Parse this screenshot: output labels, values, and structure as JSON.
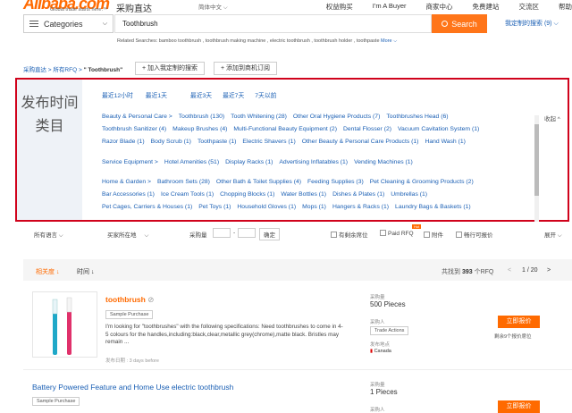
{
  "header": {
    "logo": "Alibaba.com",
    "tagline": "Global trade starts here.™",
    "site": "采购直达",
    "lang": "简体中文",
    "nav": [
      "权益购买",
      "I'm A Buyer",
      "商家中心",
      "免费建站",
      "交流区",
      "帮助"
    ]
  },
  "search": {
    "category": "Categories",
    "query": "Toothbrush",
    "button": "Search",
    "my_subs": "我定制的搜索 (9)",
    "related_label": "Related Searches:",
    "related": "bamboo toothbrush , toothbrush making machine , electric toothbrush , toothbrush holder , toothpaste",
    "more": "More"
  },
  "breadcrumb": {
    "a": "采购直达",
    "b": "所有RFQ",
    "current": "\" Toothbrush\"",
    "btn1": "+ 加入我定制的搜索",
    "btn2": "+ 添加到商机订阅"
  },
  "filters": {
    "time_label": "发布时间",
    "time": [
      "最近12小时",
      "最近1天",
      "最近3天",
      "最近7天",
      "7天以前"
    ],
    "cat_label": "类目",
    "fold": "收起",
    "row1": [
      "Beauty & Personal Care  >",
      "Toothbrush (130)",
      "Tooth Whitening (28)",
      "Other Oral Hygiene Products (7)",
      "Toothbrushes Head (6)"
    ],
    "row2": [
      "Toothbrush Sanitizer (4)",
      "Makeup Brushes (4)",
      "Multi-Functional Beauty Equipment (2)",
      "Dental Flosser (2)",
      "Vacuum Cavitation System (1)"
    ],
    "row3": [
      "Razor Blade (1)",
      "Body Scrub (1)",
      "Toothpaste (1)",
      "Electric Shavers (1)",
      "Other Beauty & Personal Care Products (1)",
      "Hand Wash (1)"
    ],
    "row4": [
      "Service Equipment  >",
      "Hotel Amenities (51)",
      "Display Racks (1)",
      "Advertising Inflatables (1)",
      "Vending Machines (1)"
    ],
    "row5": [
      "Home & Garden  >",
      "Bathroom Sets (28)",
      "Other Bath & Toilet Supplies (4)",
      "Feeding Supplies (3)",
      "Pet Cleaning & Grooming Products (2)"
    ],
    "row6": [
      "Bar Accessories (1)",
      "Ice Cream Tools (1)",
      "Chopping Blocks (1)",
      "Water Bottles (1)",
      "Dishes & Plates (1)",
      "Umbrellas (1)"
    ],
    "row7": [
      "Pet Cages, Carriers & Houses (1)",
      "Pet Toys (1)",
      "Household Gloves (1)",
      "Mops (1)",
      "Hangers & Racks (1)",
      "Laundry Bags & Baskets (1)"
    ]
  },
  "bar2": {
    "lang": "所有语言",
    "region": "买家所在地",
    "qty": "采购量",
    "dash": "-",
    "ok": "确定",
    "c1": "有剩余席位",
    "c2": "Paid RFQ",
    "c3": "附件",
    "c4": "畅行可报价",
    "hot": "Hot",
    "expand": "展开"
  },
  "sort": {
    "relevance": "相关度",
    "time": "时间",
    "found_pre": "共找到",
    "found": "393",
    "found_post": "个RFQ",
    "page": "1",
    "total": "/ 20"
  },
  "card1": {
    "title": "toothbrush",
    "tag": "Sample Purchase",
    "desc": "I'm looking for \"toothbrushes\" with the following specifications: Need toothbrushes to come in 4-5 colours for the handles,including:black,clear,metallic grey(chrome),matte black. Bristles may remain ...",
    "date": "发布日期 : 3 days before",
    "qty_label": "采购量",
    "qty": "500 Pieces",
    "buyer_label": "采购人",
    "buyer": "Trade Actions",
    "loc_label": "发布地点",
    "loc": "Canada",
    "quote": "立即报价",
    "remain": "剩余9个报价席位"
  },
  "card2": {
    "title": "Battery Powered Feature and Home Use electric toothbrush",
    "tag": "Sample Purchase",
    "qty_label": "采购量",
    "qty": "1 Pieces",
    "buyer_label": "采购人",
    "quote": "立即报价"
  }
}
